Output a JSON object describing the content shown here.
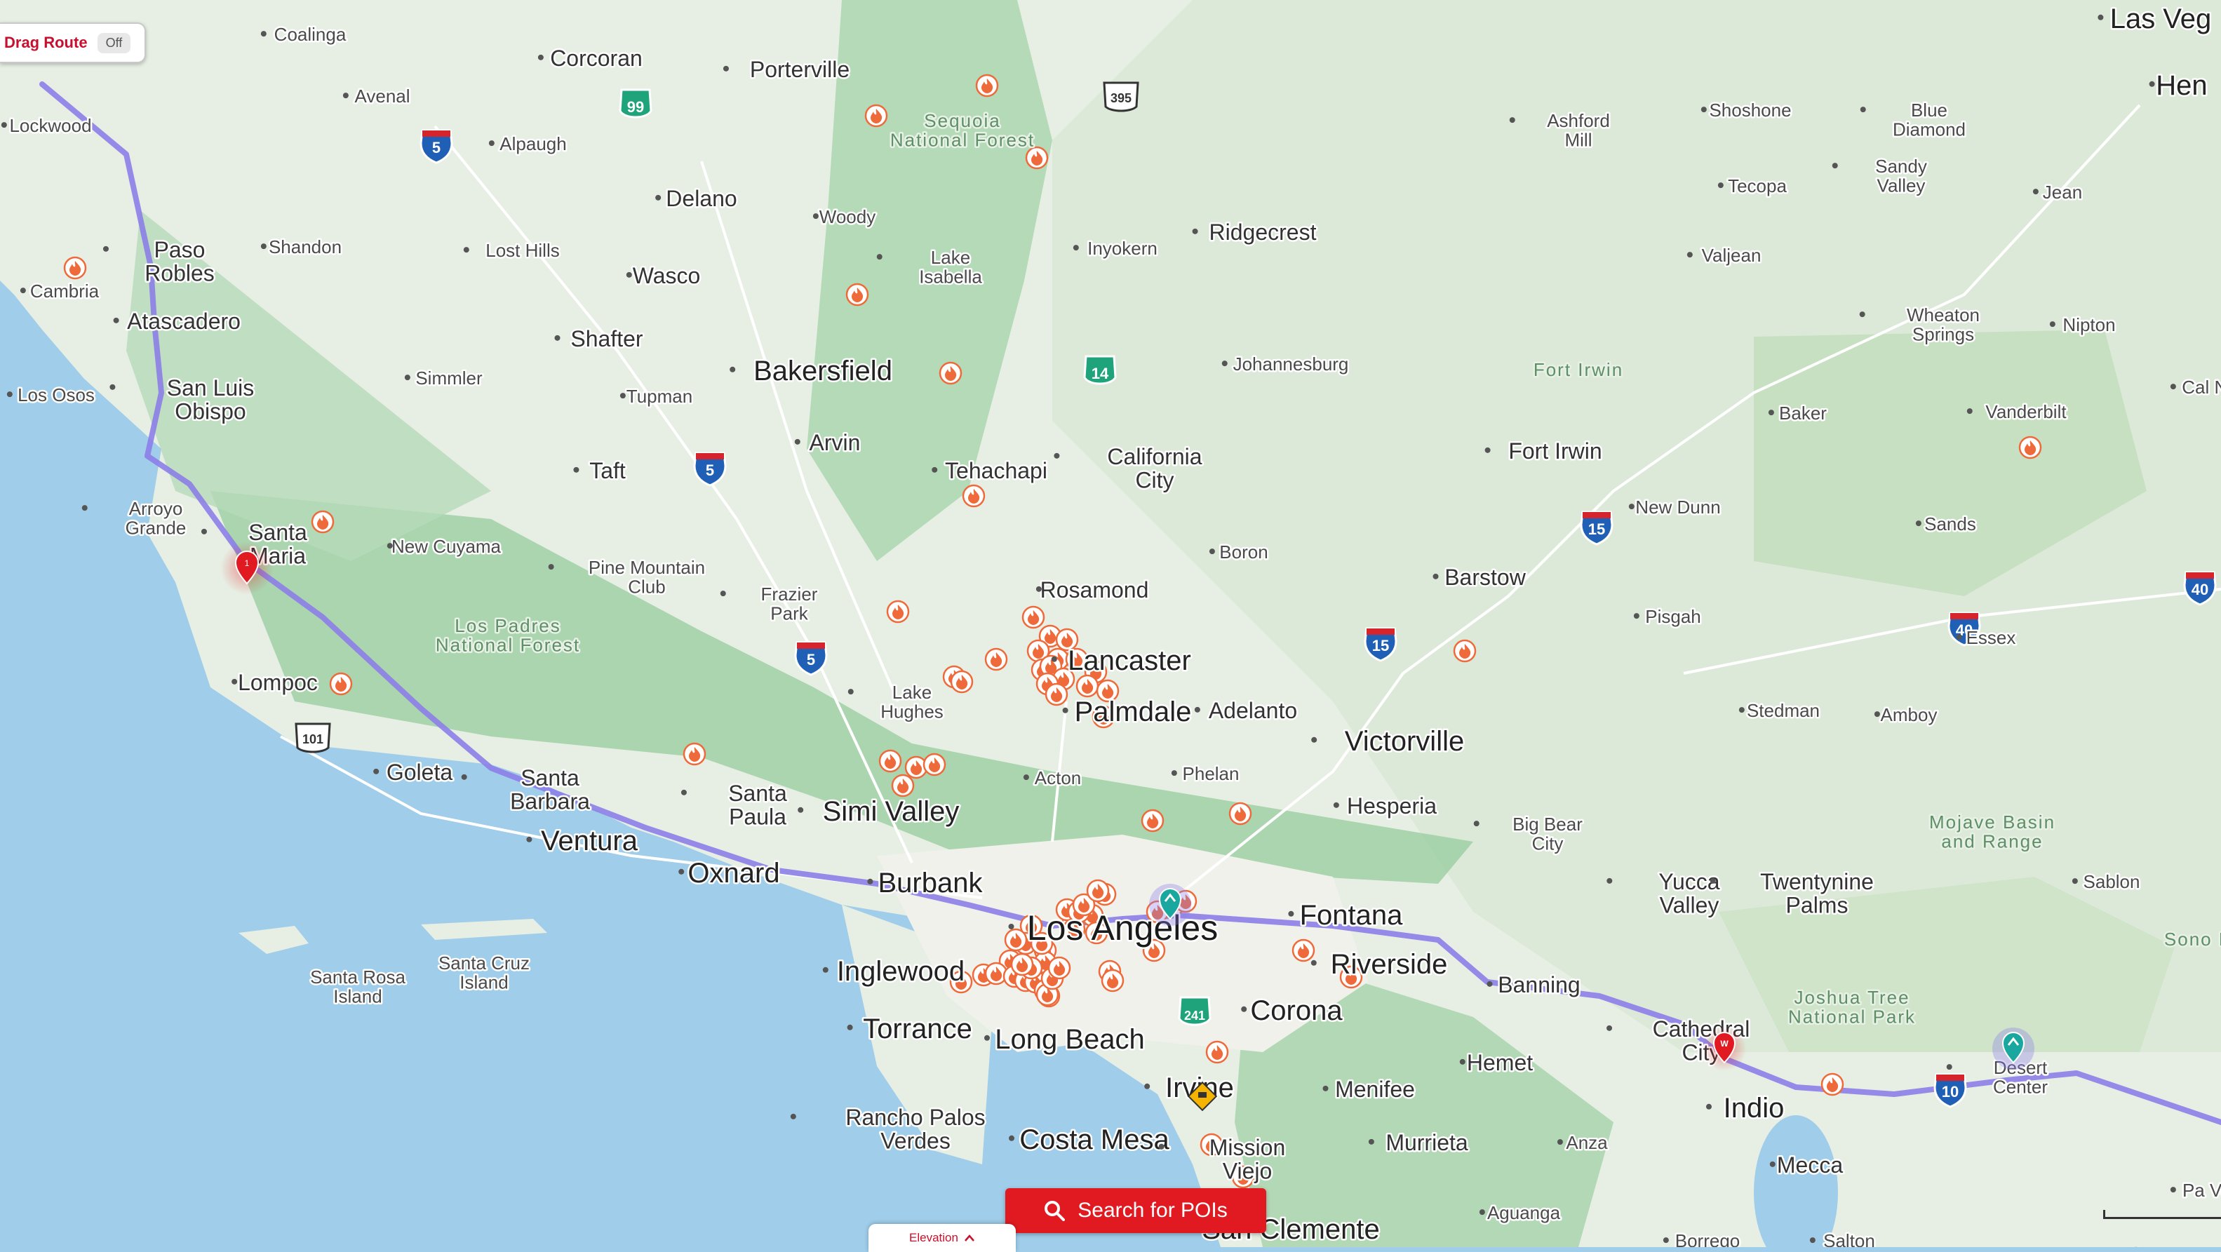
{
  "controls": {
    "drag_route_label": "Drag Route",
    "drag_route_state": "Off",
    "search_label": "Search for POIs",
    "elevation_label": "Elevation"
  },
  "colors": {
    "ocean": "#9fcdea",
    "land": "#e7efe4",
    "mountain": "#8fc79a",
    "desert": "#dbe8d7",
    "route": "#8c7ee8",
    "fire": "#ef6a3a",
    "accent": "#e11a22",
    "teal": "#1aa7a0"
  },
  "icons": {
    "fire_marker": "fire-icon",
    "search": "search-icon",
    "route_start": "map-pin-icon",
    "waypoint": "waypoint-icon",
    "charging": "charging-station-icon",
    "warning": "warning-sign-icon"
  },
  "map": {
    "places": [
      {
        "name": "Coalinga",
        "cls": "city-sm"
      },
      {
        "name": "Corcoran",
        "cls": "city-md"
      },
      {
        "name": "Porterville",
        "cls": "city-md"
      },
      {
        "name": "Avenal",
        "cls": "city-sm"
      },
      {
        "name": "Alpaugh",
        "cls": "city-sm"
      },
      {
        "name": "Lockwood",
        "cls": "city-sm"
      },
      {
        "name": "Paso Robles",
        "cls": "city-md"
      },
      {
        "name": "Shandon",
        "cls": "city-sm"
      },
      {
        "name": "Cambria",
        "cls": "city-sm"
      },
      {
        "name": "Atascadero",
        "cls": "city-md"
      },
      {
        "name": "Delano",
        "cls": "city-md"
      },
      {
        "name": "Woody",
        "cls": "city-sm"
      },
      {
        "name": "Lost Hills",
        "cls": "city-sm"
      },
      {
        "name": "Wasco",
        "cls": "city-md"
      },
      {
        "name": "Shafter",
        "cls": "city-md"
      },
      {
        "name": "Sequoia National Forest",
        "cls": "park"
      },
      {
        "name": "Lake Isabella",
        "cls": "city-sm"
      },
      {
        "name": "Inyokern",
        "cls": "city-sm"
      },
      {
        "name": "Ridgecrest",
        "cls": "city-md"
      },
      {
        "name": "Ashford Mill",
        "cls": "city-sm"
      },
      {
        "name": "Shoshone",
        "cls": "city-sm"
      },
      {
        "name": "Tecopa",
        "cls": "city-sm"
      },
      {
        "name": "Valjean",
        "cls": "city-sm"
      },
      {
        "name": "Blue Diamond",
        "cls": "city-sm"
      },
      {
        "name": "Sandy Valley",
        "cls": "city-sm"
      },
      {
        "name": "Jean",
        "cls": "city-sm"
      },
      {
        "name": "Hen",
        "cls": "city-lg"
      },
      {
        "name": "Las Veg",
        "cls": "city-lg"
      },
      {
        "name": "San Luis Obispo",
        "cls": "city-md"
      },
      {
        "name": "Los Osos",
        "cls": "city-sm"
      },
      {
        "name": "Simmler",
        "cls": "city-sm"
      },
      {
        "name": "Bakersfield",
        "cls": "city-lg"
      },
      {
        "name": "Tupman",
        "cls": "city-sm"
      },
      {
        "name": "Arvin",
        "cls": "city-md"
      },
      {
        "name": "Johannesburg",
        "cls": "city-sm"
      },
      {
        "name": "Fort Irwin",
        "cls": "park"
      },
      {
        "name": "Wheaton Springs",
        "cls": "city-sm"
      },
      {
        "name": "Nipton",
        "cls": "city-sm"
      },
      {
        "name": "Cal Ne",
        "cls": "city-sm"
      },
      {
        "name": "Baker",
        "cls": "city-sm"
      },
      {
        "name": "Vanderbilt",
        "cls": "city-sm"
      },
      {
        "name": "Taft",
        "cls": "city-md"
      },
      {
        "name": "Tehachapi",
        "cls": "city-md"
      },
      {
        "name": "California City",
        "cls": "city-md"
      },
      {
        "name": "Fort Irwin",
        "cls": "city-md"
      },
      {
        "name": "Arroyo Grande",
        "cls": "city-sm"
      },
      {
        "name": "Santa Maria",
        "cls": "city-md"
      },
      {
        "name": "New Cuyama",
        "cls": "city-sm"
      },
      {
        "name": "Pine Mountain Club",
        "cls": "city-sm"
      },
      {
        "name": "Boron",
        "cls": "city-sm"
      },
      {
        "name": "New Dunn",
        "cls": "city-sm"
      },
      {
        "name": "Sands",
        "cls": "city-sm"
      },
      {
        "name": "Los Padres National Forest",
        "cls": "park"
      },
      {
        "name": "Frazier Park",
        "cls": "city-sm"
      },
      {
        "name": "Rosamond",
        "cls": "city-md"
      },
      {
        "name": "Barstow",
        "cls": "city-md"
      },
      {
        "name": "Pisgah",
        "cls": "city-sm"
      },
      {
        "name": "Essex",
        "cls": "city-sm"
      },
      {
        "name": "Lompoc",
        "cls": "city-md"
      },
      {
        "name": "Lake Hughes",
        "cls": "city-sm"
      },
      {
        "name": "Lancaster",
        "cls": "city-lg"
      },
      {
        "name": "Palmdale",
        "cls": "city-lg"
      },
      {
        "name": "Adelanto",
        "cls": "city-md"
      },
      {
        "name": "Victorville",
        "cls": "city-lg"
      },
      {
        "name": "Stedman",
        "cls": "city-sm"
      },
      {
        "name": "Amboy",
        "cls": "city-sm"
      },
      {
        "name": "Goleta",
        "cls": "city-md"
      },
      {
        "name": "Santa Barbara",
        "cls": "city-md"
      },
      {
        "name": "Santa Paula",
        "cls": "city-md"
      },
      {
        "name": "Simi Valley",
        "cls": "city-lg"
      },
      {
        "name": "Acton",
        "cls": "city-sm"
      },
      {
        "name": "Phelan",
        "cls": "city-sm"
      },
      {
        "name": "Hesperia",
        "cls": "city-md"
      },
      {
        "name": "Big Bear City",
        "cls": "city-sm"
      },
      {
        "name": "Mojave Basin and Range",
        "cls": "park"
      },
      {
        "name": "Ventura",
        "cls": "city-lg"
      },
      {
        "name": "Oxnard",
        "cls": "city-lg"
      },
      {
        "name": "Burbank",
        "cls": "city-lg"
      },
      {
        "name": "Los Angeles",
        "cls": "city-xl"
      },
      {
        "name": "Fontana",
        "cls": "city-lg"
      },
      {
        "name": "Yucca Valley",
        "cls": "city-md"
      },
      {
        "name": "Twentynine Palms",
        "cls": "city-md"
      },
      {
        "name": "Sablon",
        "cls": "city-sm"
      },
      {
        "name": "Sono Des",
        "cls": "park"
      },
      {
        "name": "Inglewood",
        "cls": "city-lg"
      },
      {
        "name": "Riverside",
        "cls": "city-lg"
      },
      {
        "name": "Santa Rosa Island",
        "cls": "island"
      },
      {
        "name": "Santa Cruz Island",
        "cls": "island"
      },
      {
        "name": "Banning",
        "cls": "city-md"
      },
      {
        "name": "Joshua Tree National Park",
        "cls": "park"
      },
      {
        "name": "Torrance",
        "cls": "city-lg"
      },
      {
        "name": "Long Beach",
        "cls": "city-lg"
      },
      {
        "name": "Corona",
        "cls": "city-lg"
      },
      {
        "name": "Cathedral City",
        "cls": "city-md"
      },
      {
        "name": "Irvine",
        "cls": "city-lg"
      },
      {
        "name": "Hemet",
        "cls": "city-md"
      },
      {
        "name": "Menifee",
        "cls": "city-md"
      },
      {
        "name": "Desert Center",
        "cls": "city-sm"
      },
      {
        "name": "Rancho Palos Verdes",
        "cls": "city-md"
      },
      {
        "name": "Indio",
        "cls": "city-lg"
      },
      {
        "name": "Costa Mesa",
        "cls": "city-lg"
      },
      {
        "name": "Mission Viejo",
        "cls": "city-md"
      },
      {
        "name": "Murrieta",
        "cls": "city-md"
      },
      {
        "name": "Anza",
        "cls": "city-sm"
      },
      {
        "name": "Mecca",
        "cls": "city-md"
      },
      {
        "name": "San Clemente",
        "cls": "city-lg"
      },
      {
        "name": "Aguanga",
        "cls": "city-sm"
      },
      {
        "name": "Borrego",
        "cls": "city-sm"
      },
      {
        "name": "Salton",
        "cls": "city-sm"
      },
      {
        "name": "Sonoran",
        "cls": "park"
      },
      {
        "name": "Pa Ver",
        "cls": "city-sm"
      }
    ],
    "shields": [
      {
        "label": "99",
        "type": "ca"
      },
      {
        "label": "5",
        "type": "interstate"
      },
      {
        "label": "395",
        "type": "us"
      },
      {
        "label": "14",
        "type": "ca"
      },
      {
        "label": "5",
        "type": "interstate"
      },
      {
        "label": "15",
        "type": "interstate"
      },
      {
        "label": "40",
        "type": "interstate"
      },
      {
        "label": "40",
        "type": "interstate"
      },
      {
        "label": "5",
        "type": "interstate"
      },
      {
        "label": "15",
        "type": "interstate"
      },
      {
        "label": "101",
        "type": "us"
      },
      {
        "label": "241",
        "type": "ca"
      },
      {
        "label": "10",
        "type": "interstate"
      }
    ],
    "route_markers": [
      {
        "label": "1",
        "type": "start"
      },
      {
        "label": "W",
        "type": "waypoint"
      }
    ],
    "fire_count": 78
  }
}
